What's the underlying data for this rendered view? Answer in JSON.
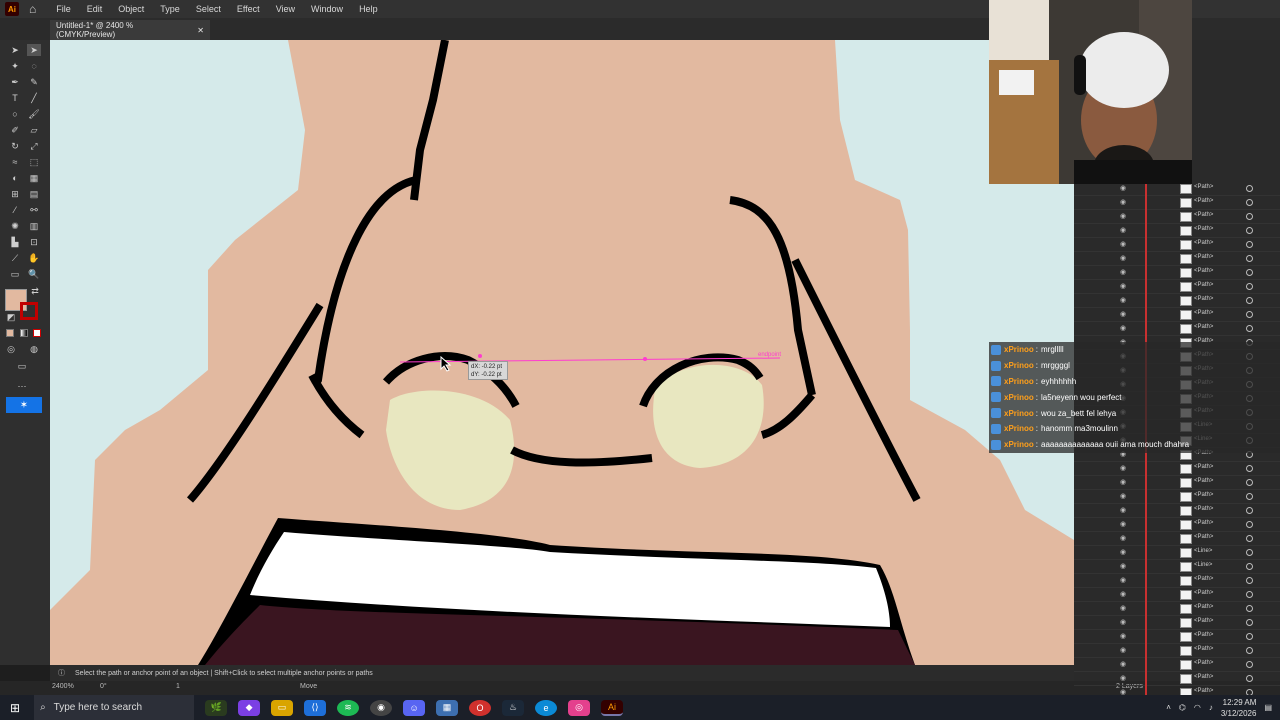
{
  "app": {
    "logo": "Ai",
    "menus": [
      "File",
      "Edit",
      "Object",
      "Type",
      "Select",
      "Effect",
      "View",
      "Window",
      "Help"
    ],
    "doc_tab": "Untitled-1* @ 2400 % (CMYK/Preview)",
    "doc_tab_close": "✕"
  },
  "canvas": {
    "tooltip_dx": "dX: -0.22 pt",
    "tooltip_dy": "dY: -0.22 pt",
    "endpoint_label": "endpoint",
    "colors": {
      "sky": "#d5eaea",
      "skin": "#e2b9a0",
      "cheek": "#e8e7c0",
      "outline": "#000000",
      "mouth_inner": "#3a1520",
      "teeth": "#ffffff",
      "guide": "#ff3ccf"
    }
  },
  "status": {
    "message": "Select the path or anchor point of an object  |  Shift+Click to select multiple anchor points or paths",
    "zoom": "2400%",
    "rotation": "0°",
    "artboard": "1",
    "tool": "Move",
    "layers_count": "2 Layers"
  },
  "layers": {
    "rows": [
      "<Path>",
      "<Path>",
      "<Path>",
      "<Path>",
      "<Path>",
      "<Path>",
      "<Path>",
      "<Path>",
      "<Path>",
      "<Path>",
      "<Path>",
      "<Path>",
      "<Path>",
      "<Path>",
      "<Path>",
      "<Path>",
      "<Path>",
      "<Line>",
      "<Line>",
      "<Path>",
      "<Path>",
      "<Path>",
      "<Path>",
      "<Path>",
      "<Path>",
      "<Path>",
      "<Line>",
      "<Line>",
      "<Path>",
      "<Path>",
      "<Path>",
      "<Path>",
      "<Path>",
      "<Path>",
      "<Path>",
      "<Path>",
      "<Path>"
    ]
  },
  "chat": [
    {
      "user": "xPrinoo",
      "msg": "mrglllll"
    },
    {
      "user": "xPrinoo",
      "msg": "mrggggl"
    },
    {
      "user": "xPrinoo",
      "msg": "eyhhhhhh"
    },
    {
      "user": "xPrinoo",
      "msg": "la5neyenn wou perfect"
    },
    {
      "user": "xPrinoo",
      "msg": "wou za_bett fel lehya"
    },
    {
      "user": "xPrinoo",
      "msg": "hanomm ma3moulinn"
    },
    {
      "user": "xPrinoo",
      "msg": "aaaaaaaaaaaaaa ouii ama mouch dhahra"
    }
  ],
  "taskbar": {
    "search_placeholder": "Type here to search",
    "time": "12:29 AM",
    "date": "3/12/2026"
  }
}
